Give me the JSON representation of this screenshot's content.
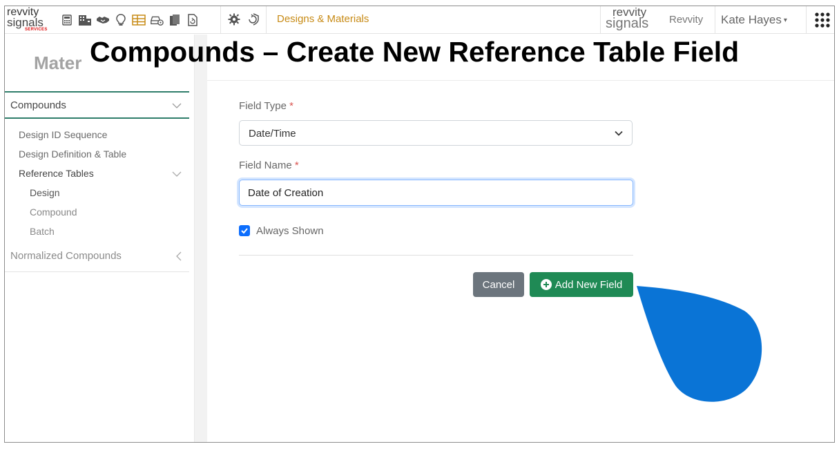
{
  "header": {
    "brand_left_line1": "revvity",
    "brand_left_line2": "signals",
    "brand_left_services": "SERVICES",
    "section_link": "Designs & Materials",
    "brand_right_line1": "revvity",
    "brand_right_line2": "signals",
    "tenant": "Revvity",
    "user_name": "Kate Hayes",
    "nav_icons": [
      "calculator-icon",
      "building-icon",
      "handshake-icon",
      "lightbulb-icon",
      "table-icon",
      "car-settings-icon",
      "clipboard-icon",
      "document-refresh-icon"
    ],
    "settings_icons": [
      "gear-icon",
      "shield-refresh-icon"
    ],
    "apps_icon": "grid-apps-icon",
    "accent_color": "#c78a14"
  },
  "overlay": {
    "title": "Compounds – Create New Reference Table Field"
  },
  "sidebar": {
    "title": "Mater",
    "section_label": "Compounds",
    "items": [
      {
        "label": "Design ID Sequence"
      },
      {
        "label": "Design Definition & Table"
      },
      {
        "label": "Reference Tables"
      },
      {
        "label": "Design"
      },
      {
        "label": "Compound"
      },
      {
        "label": "Batch"
      }
    ],
    "other_section": "Normalized Compounds",
    "accent_color": "#2e7d6a"
  },
  "form": {
    "field_type_label": "Field Type",
    "field_type_value": "Date/Time",
    "field_name_label": "Field Name",
    "field_name_value": "Date of Creation",
    "required_mark": "*",
    "always_shown_label": "Always Shown",
    "always_shown_checked": true,
    "cancel_label": "Cancel",
    "add_label": "Add New Field",
    "cancel_color": "#6c757d",
    "add_color": "#1f8a55"
  }
}
